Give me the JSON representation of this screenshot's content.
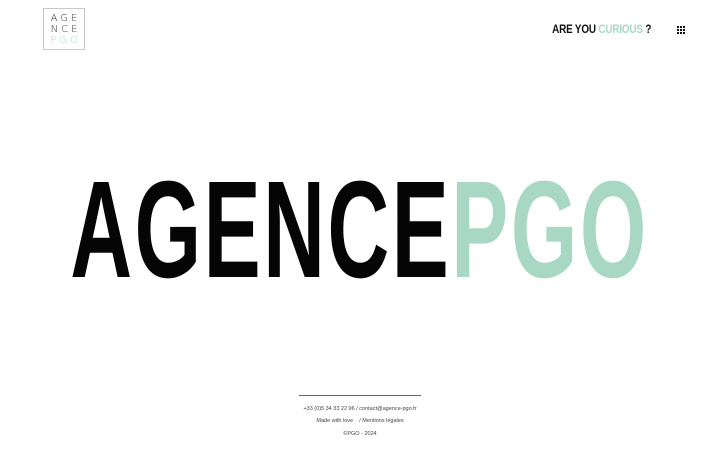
{
  "header": {
    "logo": {
      "row1": "AGE",
      "row2": "NCE",
      "row3": "PGO"
    },
    "tagline": {
      "dark_part": "ARE YOU ",
      "accent_part": "CURIOUS",
      "end_part": " ?"
    },
    "menu_icon": "grid-menu-icon"
  },
  "hero": {
    "dark_word": "AGENCE",
    "accent_word": "PGO"
  },
  "footer": {
    "phone": "+33 (0)5 34 33 22 96",
    "email_prefix": " / ",
    "email": "contact@agence-pgo.fr",
    "made_with": "Made with love",
    "legal_prefix": "/ ",
    "legal_link": "Mentions légales",
    "copyright": "©PGO - 2024"
  },
  "colors": {
    "accent": "#a8d8c4",
    "text": "#050505",
    "background": "#ffffff"
  }
}
